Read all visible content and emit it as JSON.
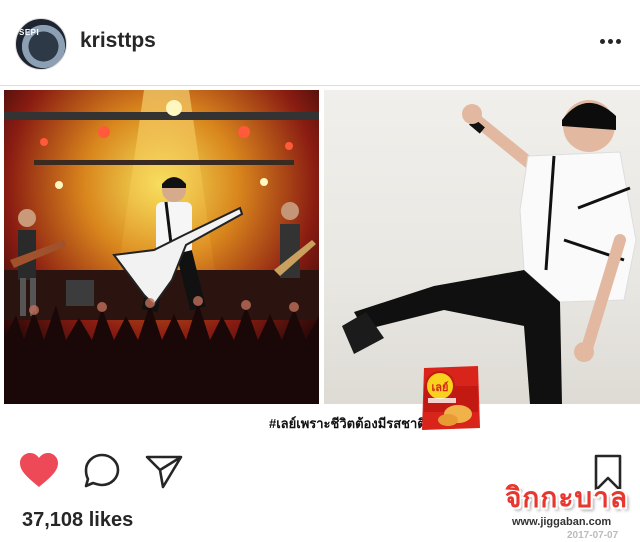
{
  "header": {
    "username": "kristtps",
    "avatar_text": "SEPI",
    "more_icon": "more-horizontal-icon"
  },
  "post": {
    "caption_hashtag": "#เลย์เพราะชีวิตต้องมีรสชาติ",
    "product_label": "เลย์"
  },
  "actions": {
    "like_icon": "heart-filled-icon",
    "comment_icon": "comment-icon",
    "share_icon": "send-icon",
    "save_icon": "bookmark-icon",
    "like_color": "#ed4956",
    "likes_text": "37,108 likes"
  },
  "watermark": {
    "logo": "จิกกะบาล",
    "url": "www.jiggaban.com",
    "date": "2017-07-07"
  }
}
